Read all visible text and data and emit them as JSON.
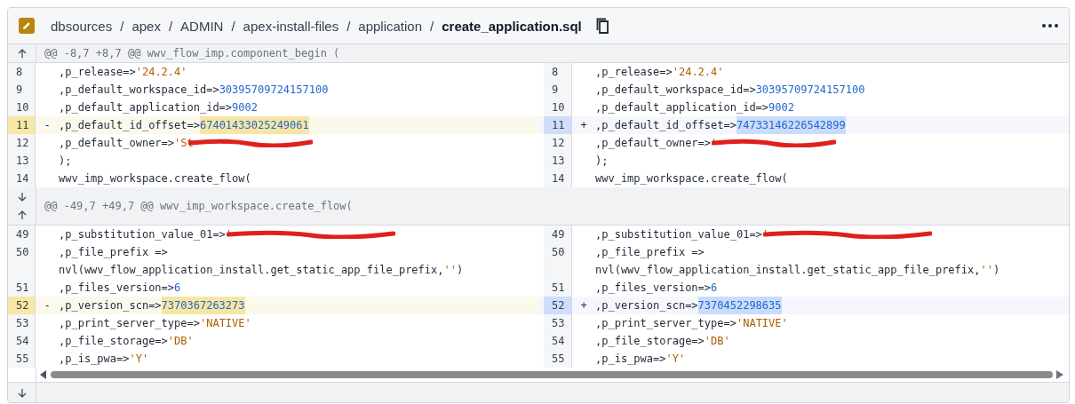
{
  "breadcrumb": [
    {
      "label": "dbsources",
      "current": false
    },
    {
      "label": "apex",
      "current": false
    },
    {
      "label": "ADMIN",
      "current": false
    },
    {
      "label": "apex-install-files",
      "current": false
    },
    {
      "label": "application",
      "current": false
    },
    {
      "label": "create_application.sql",
      "current": true
    }
  ],
  "separator": "/",
  "hunks": [
    {
      "header": "@@ -8,7 +8,7 @@ wwv_flow_imp.component_begin (",
      "expand": [
        {
          "kind": "up"
        }
      ],
      "rows": [
        {
          "left": {
            "num": "8",
            "kind": "context",
            "tokens": [
              {
                "kind": "plain",
                "text": ",p_release=>"
              },
              {
                "kind": "string",
                "text": "'24.2.4'"
              }
            ]
          },
          "right": {
            "num": "8",
            "kind": "context",
            "tokens": [
              {
                "kind": "plain",
                "text": ",p_release=>"
              },
              {
                "kind": "string",
                "text": "'24.2.4'"
              }
            ]
          }
        },
        {
          "left": {
            "num": "9",
            "kind": "context",
            "tokens": [
              {
                "kind": "plain",
                "text": ",p_default_workspace_id=>"
              },
              {
                "kind": "number",
                "text": "30395709724157100"
              }
            ]
          },
          "right": {
            "num": "9",
            "kind": "context",
            "tokens": [
              {
                "kind": "plain",
                "text": ",p_default_workspace_id=>"
              },
              {
                "kind": "number",
                "text": "30395709724157100"
              }
            ]
          }
        },
        {
          "left": {
            "num": "10",
            "kind": "context",
            "tokens": [
              {
                "kind": "plain",
                "text": ",p_default_application_id=>"
              },
              {
                "kind": "number",
                "text": "9002"
              }
            ]
          },
          "right": {
            "num": "10",
            "kind": "context",
            "tokens": [
              {
                "kind": "plain",
                "text": ",p_default_application_id=>"
              },
              {
                "kind": "number",
                "text": "9002"
              }
            ]
          }
        },
        {
          "left": {
            "num": "11",
            "kind": "removed",
            "marker": "-",
            "tokens": [
              {
                "kind": "plain",
                "text": ",p_default_id_offset=>"
              },
              {
                "kind": "number",
                "text": "67401433025249061",
                "changed": true
              }
            ]
          },
          "right": {
            "num": "11",
            "kind": "added",
            "marker": "+",
            "tokens": [
              {
                "kind": "plain",
                "text": ",p_default_id_offset=>"
              },
              {
                "kind": "number",
                "text": "74733146226542899",
                "changed": true
              }
            ]
          }
        },
        {
          "left": {
            "num": "12",
            "kind": "context",
            "tokens": [
              {
                "kind": "plain",
                "text": ",p_default_owner=>"
              },
              {
                "kind": "string",
                "text": "'St"
              },
              {
                "kind": "redacted_short"
              }
            ]
          },
          "right": {
            "num": "12",
            "kind": "context",
            "tokens": [
              {
                "kind": "plain",
                "text": ",p_default_owner=>"
              },
              {
                "kind": "string",
                "text": "'"
              },
              {
                "kind": "redacted_short"
              }
            ]
          }
        },
        {
          "left": {
            "num": "13",
            "kind": "context",
            "tokens": [
              {
                "kind": "plain",
                "text": ");"
              }
            ]
          },
          "right": {
            "num": "13",
            "kind": "context",
            "tokens": [
              {
                "kind": "plain",
                "text": ");"
              }
            ]
          }
        },
        {
          "left": {
            "num": "14",
            "kind": "context",
            "tokens": [
              {
                "kind": "plain",
                "text": "wwv_imp_workspace.create_flow("
              }
            ]
          },
          "right": {
            "num": "14",
            "kind": "context",
            "tokens": [
              {
                "kind": "plain",
                "text": "wwv_imp_workspace.create_flow("
              }
            ]
          }
        }
      ]
    },
    {
      "header": "@@ -49,7 +49,7 @@ wwv_imp_workspace.create_flow(",
      "expand": [
        {
          "kind": "down"
        },
        {
          "kind": "up"
        }
      ],
      "rows": [
        {
          "left": {
            "num": "49",
            "kind": "context",
            "tokens": [
              {
                "kind": "plain",
                "text": ",p_substitution_value_01=>"
              },
              {
                "kind": "string",
                "text": "'"
              },
              {
                "kind": "redacted_long"
              }
            ]
          },
          "right": {
            "num": "49",
            "kind": "context",
            "tokens": [
              {
                "kind": "plain",
                "text": ",p_substitution_value_01=>"
              },
              {
                "kind": "string",
                "text": "'"
              },
              {
                "kind": "redacted_long"
              }
            ]
          }
        },
        {
          "left": {
            "num": "50",
            "kind": "context",
            "tokens": [
              {
                "kind": "plain",
                "text": ",p_file_prefix =>"
              }
            ]
          },
          "right": {
            "num": "50",
            "kind": "context",
            "tokens": [
              {
                "kind": "plain",
                "text": ",p_file_prefix =>"
              }
            ]
          }
        },
        {
          "left": {
            "kind": "context",
            "tokens": [
              {
                "kind": "plain",
                "text": "nvl(wwv_flow_application_install.get_static_app_file_prefix,"
              },
              {
                "kind": "string",
                "text": "''"
              },
              {
                "kind": "plain",
                "text": ")"
              }
            ]
          },
          "right": {
            "kind": "context",
            "tokens": [
              {
                "kind": "plain",
                "text": "nvl(wwv_flow_application_install.get_static_app_file_prefix,"
              },
              {
                "kind": "string",
                "text": "''"
              },
              {
                "kind": "plain",
                "text": ")"
              }
            ]
          }
        },
        {
          "left": {
            "num": "51",
            "kind": "context",
            "tokens": [
              {
                "kind": "plain",
                "text": ",p_files_version=>"
              },
              {
                "kind": "number",
                "text": "6"
              }
            ]
          },
          "right": {
            "num": "51",
            "kind": "context",
            "tokens": [
              {
                "kind": "plain",
                "text": ",p_files_version=>"
              },
              {
                "kind": "number",
                "text": "6"
              }
            ]
          }
        },
        {
          "left": {
            "num": "52",
            "kind": "removed",
            "marker": "-",
            "tokens": [
              {
                "kind": "plain",
                "text": ",p_version_scn=>"
              },
              {
                "kind": "number",
                "text": "7370367263273",
                "changed": true
              }
            ]
          },
          "right": {
            "num": "52",
            "kind": "added",
            "marker": "+",
            "tokens": [
              {
                "kind": "plain",
                "text": ",p_version_scn=>"
              },
              {
                "kind": "number",
                "text": "7370452298635",
                "changed": true
              }
            ]
          }
        },
        {
          "left": {
            "num": "53",
            "kind": "context",
            "tokens": [
              {
                "kind": "plain",
                "text": ",p_print_server_type=>"
              },
              {
                "kind": "string",
                "text": "'NATIVE'"
              }
            ]
          },
          "right": {
            "num": "53",
            "kind": "context",
            "tokens": [
              {
                "kind": "plain",
                "text": ",p_print_server_type=>"
              },
              {
                "kind": "string",
                "text": "'NATIVE'"
              }
            ]
          }
        },
        {
          "left": {
            "num": "54",
            "kind": "context",
            "tokens": [
              {
                "kind": "plain",
                "text": ",p_file_storage=>"
              },
              {
                "kind": "string",
                "text": "'DB'"
              }
            ]
          },
          "right": {
            "num": "54",
            "kind": "context",
            "tokens": [
              {
                "kind": "plain",
                "text": ",p_file_storage=>"
              },
              {
                "kind": "string",
                "text": "'DB'"
              }
            ]
          }
        },
        {
          "left": {
            "num": "55",
            "kind": "context",
            "tokens": [
              {
                "kind": "plain",
                "text": ",p_is_pwa=>"
              },
              {
                "kind": "string",
                "text": "'Y'"
              }
            ]
          },
          "right": {
            "num": "55",
            "kind": "context",
            "tokens": [
              {
                "kind": "plain",
                "text": ",p_is_pwa=>"
              },
              {
                "kind": "string",
                "text": "'Y'"
              }
            ]
          }
        }
      ]
    }
  ],
  "footer_expand": [
    {
      "kind": "down"
    }
  ]
}
